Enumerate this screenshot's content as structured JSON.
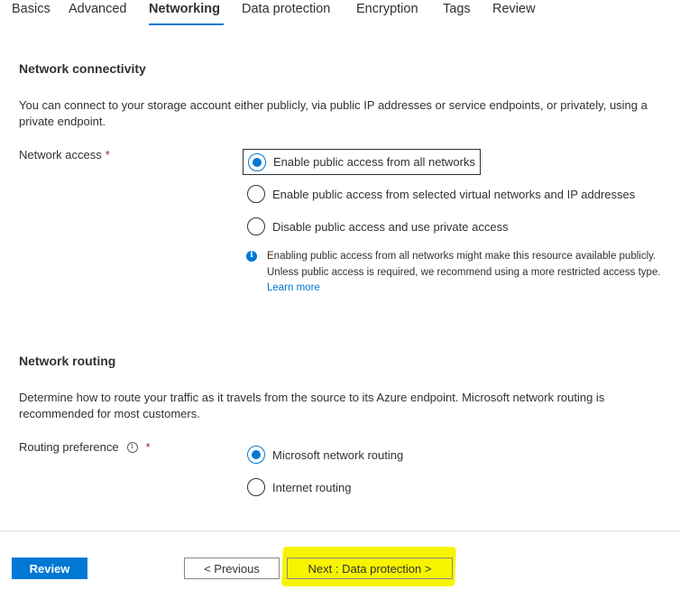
{
  "tabs": [
    {
      "label": "Basics"
    },
    {
      "label": "Advanced"
    },
    {
      "label": "Networking"
    },
    {
      "label": "Data protection"
    },
    {
      "label": "Encryption"
    },
    {
      "label": "Tags"
    },
    {
      "label": "Review"
    }
  ],
  "active_tab": "Networking",
  "network_connectivity": {
    "title": "Network connectivity",
    "description": "You can connect to your storage account either publicly, via public IP addresses or service endpoints, or privately, using a private endpoint.",
    "network_access_label": "Network access",
    "required_marker": "*",
    "options": [
      {
        "label": "Enable public access from all networks",
        "selected": true
      },
      {
        "label": "Enable public access from selected virtual networks and IP addresses",
        "selected": false
      },
      {
        "label": "Disable public access and use private access",
        "selected": false
      }
    ],
    "info_text": "Enabling public access from all networks might make this resource available publicly. Unless public access is required, we recommend using a more restricted access type.",
    "info_link": "Learn more"
  },
  "network_routing": {
    "title": "Network routing",
    "description": "Determine how to route your traffic as it travels from the source to its Azure endpoint. Microsoft network routing is recommended for most customers.",
    "routing_label": "Routing preference",
    "required_marker": "*",
    "options": [
      {
        "label": "Microsoft network routing",
        "selected": true
      },
      {
        "label": "Internet routing",
        "selected": false
      }
    ]
  },
  "footer": {
    "review_label": "Review",
    "previous_label": "< Previous",
    "next_label": "Next : Data protection >"
  },
  "colors": {
    "accent": "#0078d4",
    "highlight": "#f8f400"
  }
}
